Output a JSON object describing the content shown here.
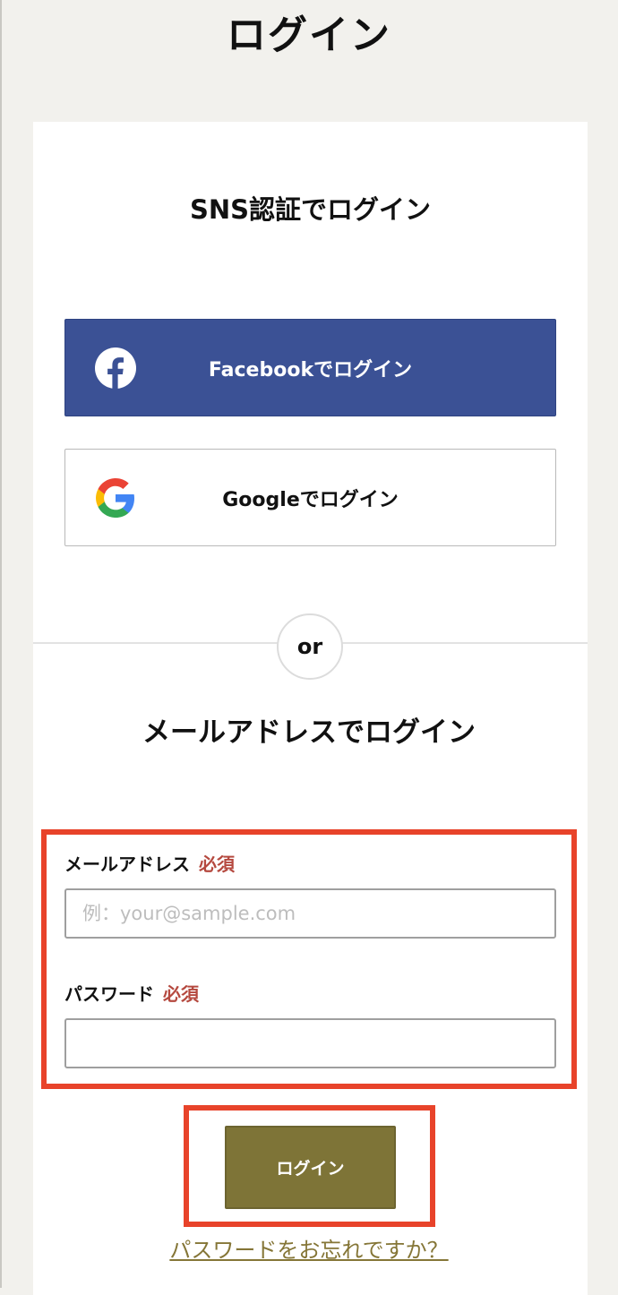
{
  "page": {
    "title": "ログイン"
  },
  "sns": {
    "heading": "SNS認証でログイン",
    "facebook_label": "Facebookでログイン",
    "google_label": "Googleでログイン"
  },
  "divider": {
    "text": "or"
  },
  "mail": {
    "heading": "メールアドレスでログイン",
    "email_label": "メールアドレス",
    "email_required": "必須",
    "email_placeholder": "例：your@sample.com",
    "email_value": "",
    "password_label": "パスワード",
    "password_required": "必須",
    "password_value": ""
  },
  "actions": {
    "login_label": "ログイン",
    "forgot_password": "パスワードをお忘れですか？"
  },
  "colors": {
    "facebook_blue": "#3b5195",
    "login_olive": "#7e7437",
    "required_red": "#b5493f",
    "highlight_red": "#e8432a",
    "page_bg": "#f2f1ed"
  },
  "icons": {
    "facebook": "facebook-logo-icon",
    "google": "google-logo-icon"
  }
}
